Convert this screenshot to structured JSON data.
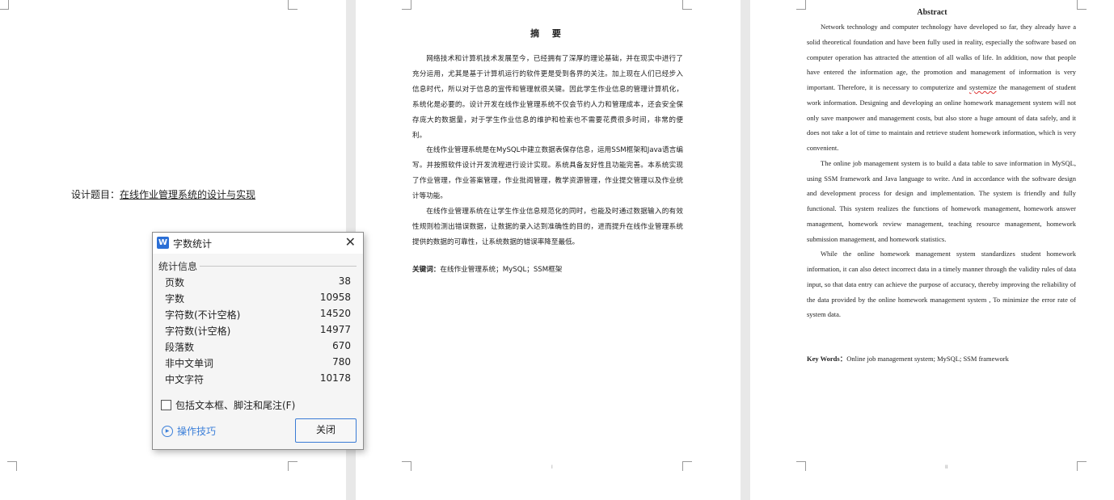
{
  "page1": {
    "design_title_prefix": "设计题目：",
    "design_title": "在线作业管理系统的设计与实现"
  },
  "page2": {
    "heading": "摘 要",
    "paragraphs": [
      "网络技术和计算机技术发展至今，已经拥有了深厚的理论基础，并在现实中进行了充分运用，尤其是基于计算机运行的软件更是受到各界的关注。加上现在人们已经步入信息时代，所以对于信息的宣传和管理就很关键。因此学生作业信息的管理计算机化，系统化是必要的。设计开发在线作业管理系统不仅会节约人力和管理成本，还会安全保存庞大的数据量，对于学生作业信息的维护和检索也不需要花费很多时间，非常的便利。",
      "在线作业管理系统是在MySQL中建立数据表保存信息，运用SSM框架和Java语言编写。并按照软件设计开发流程进行设计实现。系统具备友好性且功能完善。本系统实现了作业管理，作业答案管理，作业批阅管理，教学资源管理，作业提交管理以及作业统计等功能。",
      "在线作业管理系统在让学生作业信息规范化的同时，也能及时通过数据输入的有效性规则检测出错误数据，让数据的录入达到准确性的目的，进而提升在线作业管理系统提供的数据的可靠性，让系统数据的错误率降至最低。"
    ],
    "keywords_label": "关键词：",
    "keywords": "在线作业管理系统；MySQL；SSM框架",
    "page_num": "I"
  },
  "page3": {
    "heading": "Abstract",
    "para1_before": "Network technology and computer technology have developed so far, they already have a solid theoretical foundation and have been fully used in reality, especially the software based on computer operation has attracted the attention of all walks of life. In addition, now that people have entered the information age, the promotion and management of information is very important. Therefore, it is necessary to computerize and ",
    "para1_flagged": "systemize",
    "para1_after": " the management of student work information. Designing and developing an online homework management system will not only save manpower and management costs, but also store a huge amount of data safely, and it does not take a lot of time to maintain and retrieve student homework information, which is very convenient.",
    "para2": "The online job management system is to build a data table to save information in MySQL, using SSM framework and Java language to write. And in accordance with the software design and development process for design and implementation. The system is friendly and fully functional. This system realizes the functions of homework management, homework answer management, homework review management, teaching resource management, homework submission management, and homework statistics.",
    "para3": "While the online homework management system standardizes student homework information, it can also detect incorrect data in a timely manner through the validity rules of data input, so that data entry can achieve the purpose of accuracy, thereby improving the reliability of the data provided by the online homework management system , To minimize the error rate of system data.",
    "keywords_label": "Key Words：",
    "keywords": "Online job management system; MySQL; SSM framework",
    "page_num": "II"
  },
  "dialog": {
    "app_icon": "W",
    "title": "字数统计",
    "section_label": "统计信息",
    "stats": [
      {
        "label": "页数",
        "value": "38"
      },
      {
        "label": "字数",
        "value": "10958"
      },
      {
        "label": "字符数(不计空格)",
        "value": "14520"
      },
      {
        "label": "字符数(计空格)",
        "value": "14977"
      },
      {
        "label": "段落数",
        "value": "670"
      },
      {
        "label": "非中文单词",
        "value": "780"
      },
      {
        "label": "中文字符",
        "value": "10178"
      }
    ],
    "checkbox_label": "包括文本框、脚注和尾注(F)",
    "checkbox_checked": false,
    "tips_label": "操作技巧",
    "close_button": "关闭",
    "close_icon": "close-icon",
    "tips_icon": "play-circle-icon"
  }
}
